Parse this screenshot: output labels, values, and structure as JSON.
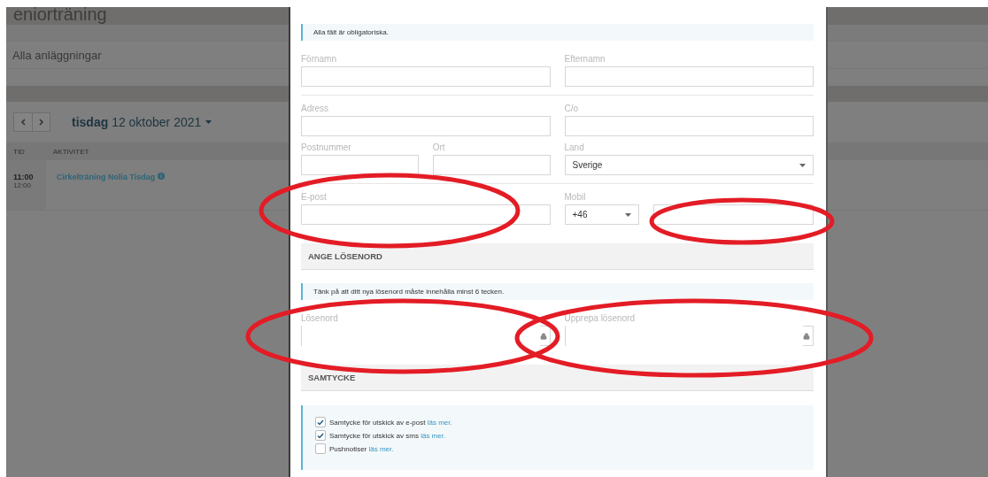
{
  "background_page": {
    "title": "eniorträning",
    "facility_filter": "Alla anläggningar",
    "date_nav": {
      "weekday": "tisdag",
      "date": "12 oktober 2021"
    },
    "table": {
      "columns": [
        "TID",
        "AKTIVITET"
      ],
      "rows": [
        {
          "start": "11:00",
          "end": "12:00",
          "activity": "Cirkelträning Nolia Tisdag"
        }
      ]
    }
  },
  "modal": {
    "items": [
      {
        "kind": "notice",
        "text": "Alla fält är obligatoriska."
      },
      {
        "kind": "row",
        "columns": [
          [
            {
              "kind": "text",
              "label": "Förnamn"
            }
          ],
          [
            {
              "kind": "text",
              "label": "Efternamn"
            }
          ]
        ]
      },
      {
        "kind": "divider"
      },
      {
        "kind": "row",
        "columns": [
          [
            {
              "kind": "text",
              "label": "Adress"
            }
          ],
          [
            {
              "kind": "text",
              "label": "C/o"
            }
          ]
        ]
      },
      {
        "kind": "row",
        "columns": [
          [
            {
              "kind": "text",
              "label": "Postnummer"
            },
            {
              "kind": "text",
              "label": "Ort"
            }
          ],
          [
            {
              "kind": "select",
              "label": "Land",
              "value": "Sverige"
            }
          ]
        ]
      },
      {
        "kind": "divider"
      },
      {
        "kind": "row",
        "columns": [
          [
            {
              "kind": "text",
              "label": "E-post"
            }
          ],
          [
            {
              "kind": "phone",
              "label": "Mobil",
              "prefix": "+46"
            }
          ]
        ]
      },
      {
        "kind": "section",
        "title": "ANGE LÖSENORD"
      },
      {
        "kind": "notice",
        "text": "Tänk på att ditt nya lösenord måste innehålla minst 6 tecken."
      },
      {
        "kind": "row",
        "columns": [
          [
            {
              "kind": "password",
              "label": "Lösenord"
            }
          ],
          [
            {
              "kind": "password",
              "label": "Upprepa lösenord"
            }
          ]
        ]
      },
      {
        "kind": "section",
        "title": "SAMTYCKE"
      },
      {
        "kind": "consent",
        "items": [
          {
            "text": "Samtycke för utskick av e-post",
            "link": "läs mer.",
            "checked": true
          },
          {
            "text": "Samtycke för utskick av sms",
            "link": "läs mer.",
            "checked": true
          },
          {
            "text": "Pushnotiser",
            "link": "läs mer.",
            "checked": false
          }
        ]
      }
    ]
  }
}
